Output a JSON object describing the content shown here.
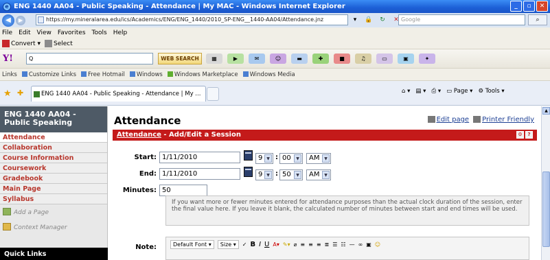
{
  "window": {
    "title": "ENG 1440 AA04 - Public Speaking - Attendance | My MAC - Windows Internet Explorer"
  },
  "address": {
    "url": "https://my.mineralarea.edu/ics/Academics/ENG/ENG_1440/2010_SP-ENG__1440-AA04/Attendance.jnz",
    "search_placeholder": "Google"
  },
  "menu": [
    "File",
    "Edit",
    "View",
    "Favorites",
    "Tools",
    "Help"
  ],
  "convert_bar": {
    "convert": "Convert",
    "select": "Select"
  },
  "yahoo": {
    "logo": "Y!",
    "search_value": "Q",
    "web_search": "WEB SEARCH"
  },
  "links_bar": [
    "Links",
    "Customize Links",
    "Free Hotmail",
    "Windows",
    "Windows Marketplace",
    "Windows Media"
  ],
  "tab": {
    "title": "ENG 1440 AA04 - Public Speaking - Attendance | My ..."
  },
  "commands": {
    "page": "Page",
    "tools": "Tools"
  },
  "sidebar": {
    "course_title": "ENG 1440 AA04 - Public Speaking",
    "items": [
      {
        "label": "Attendance"
      },
      {
        "label": "Collaboration"
      },
      {
        "label": "Course Information"
      },
      {
        "label": "Coursework"
      },
      {
        "label": "Gradebook"
      },
      {
        "label": "Main Page"
      },
      {
        "label": "Syllabus"
      }
    ],
    "add_page": "Add a Page",
    "context_manager": "Context Manager",
    "quick_links": "Quick Links"
  },
  "main": {
    "title": "Attendance",
    "edit_page": "Edit page",
    "printer_friendly": "Printer Friendly",
    "panel_link": "Attendance",
    "panel_title": " - Add/Edit a Session",
    "start_label": "Start:",
    "start_date": "1/11/2010",
    "start_hour": "9",
    "start_min": "00",
    "start_ampm": "AM",
    "end_label": "End:",
    "end_date": "1/11/2010",
    "end_hour": "9",
    "end_min": "50",
    "end_ampm": "AM",
    "minutes_label": "Minutes:",
    "minutes_value": "50",
    "help_text": "If you want more or fewer minutes entered for attendance purposes than the actual clock duration of the session, enter the final value here. If you leave it blank, the calculated number of minutes between start and end times will be used.",
    "note_label": "Note:",
    "editor_font": "Default Font",
    "editor_size": "Size"
  }
}
